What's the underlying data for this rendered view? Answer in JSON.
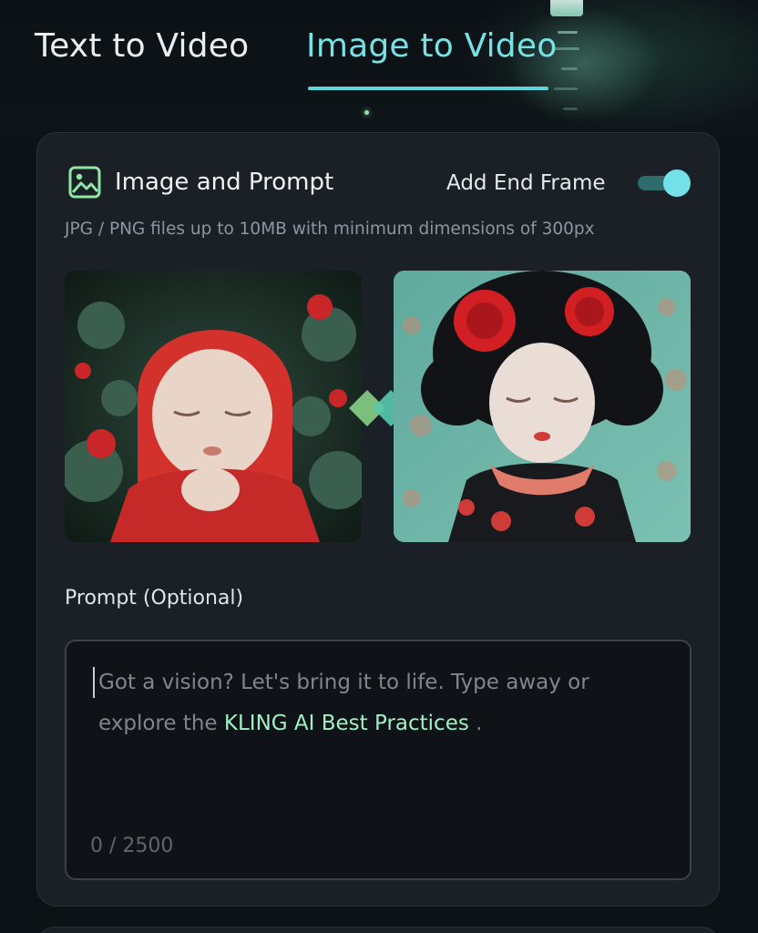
{
  "tabs": [
    {
      "label": "Text to Video",
      "active": false
    },
    {
      "label": "Image to Video",
      "active": true
    }
  ],
  "section": {
    "title": "Image and Prompt",
    "icon": "image-icon",
    "end_frame_label": "Add End Frame",
    "end_frame_enabled": true,
    "hint": "JPG / PNG files up to 10MB with minimum dimensions of 300px"
  },
  "images": {
    "start_frame": {
      "icon": "portrait-image"
    },
    "end_frame": {
      "icon": "portrait-image"
    },
    "link_icon": "diamond-link-icon"
  },
  "prompt": {
    "label": "Prompt (Optional)",
    "placeholder_line1": "Got a vision? Let's bring it to life. Type away or",
    "placeholder_line2_prefix": "explore the ",
    "placeholder_link": "KLING AI Best Practices",
    "placeholder_line2_suffix": " .",
    "counter": "0 / 2500",
    "value": ""
  },
  "colors": {
    "accent": "#79e0e4",
    "link": "#9ff0c4",
    "card_bg": "#1a2026",
    "page_bg": "#0d1216"
  }
}
